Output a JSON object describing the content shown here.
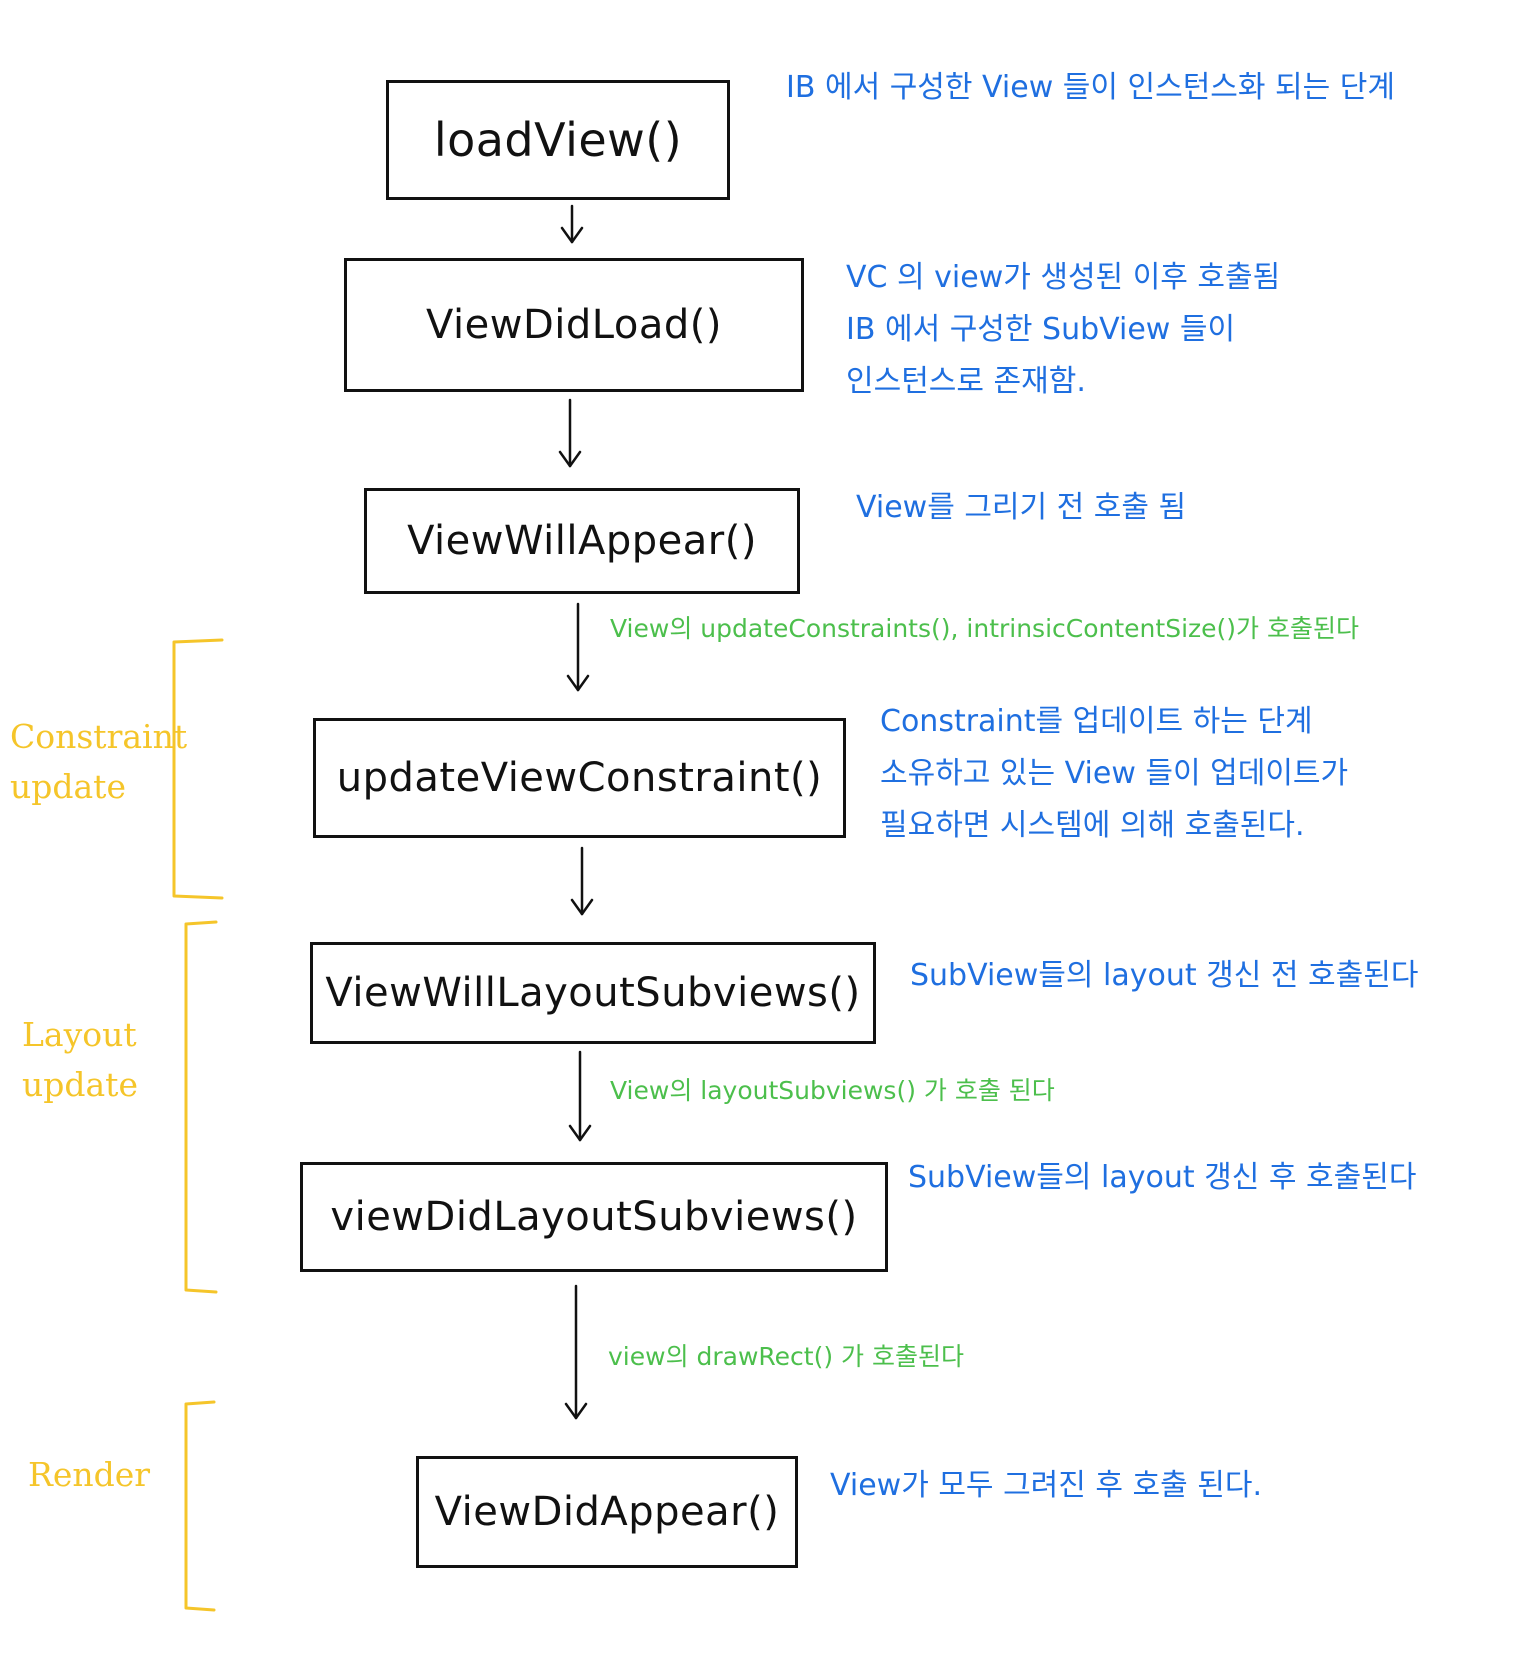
{
  "colors": {
    "stroke": "#111111",
    "note": "#1f6fe0",
    "call": "#4cbf4c",
    "phase": "#f5c52a"
  },
  "steps": [
    {
      "label": "loadView()",
      "note": [
        "IB 에서 구성한 View 들이 인스턴스화 되는 단계"
      ]
    },
    {
      "label": "ViewDidLoad()",
      "note": [
        "VC 의 view가 생성된 이후 호출됨",
        "IB 에서 구성한 SubView 들이",
        "인스턴스로 존재함."
      ]
    },
    {
      "label": "ViewWillAppear()",
      "note": [
        "View를 그리기 전 호출 됨"
      ]
    },
    {
      "label": "updateViewConstraint()",
      "note": [
        "Constraint를 업데이트 하는 단계",
        "소유하고 있는 View 들이 업데이트가",
        "필요하면 시스템에 의해 호출된다."
      ]
    },
    {
      "label": "ViewWillLayoutSubviews()",
      "note": [
        "SubView들의 layout 갱신 전 호출된다"
      ]
    },
    {
      "label": "viewDidLayoutSubviews()",
      "note": [
        "SubView들의 layout 갱신 후 호출된다"
      ]
    },
    {
      "label": "ViewDidAppear()",
      "note": [
        "View가 모두 그려진 후 호출 된다."
      ]
    }
  ],
  "calls": [
    "View의 updateConstraints(), intrinsicContentSize()가 호출된다",
    "View의 layoutSubviews() 가 호출 된다",
    "view의 drawRect() 가 호출된다"
  ],
  "phases": [
    {
      "label": [
        "Constraint",
        "update"
      ]
    },
    {
      "label": [
        "Layout",
        "update"
      ]
    },
    {
      "label": [
        "Render"
      ]
    }
  ]
}
